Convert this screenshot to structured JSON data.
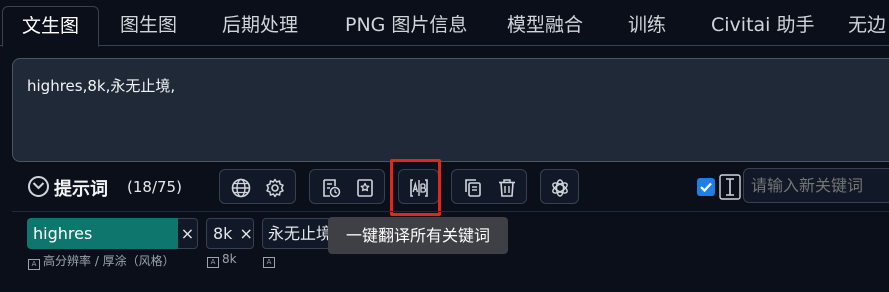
{
  "tabs": [
    "文生图",
    "图生图",
    "后期处理",
    "PNG 图片信息",
    "模型融合",
    "训练",
    "Civitai 助手",
    "无边"
  ],
  "prompt": {
    "text": "highres,8k,永无止境,"
  },
  "toolbar": {
    "title": "提示词",
    "count": "(18/75)",
    "input_placeholder": "请输入新关键词",
    "checkbox_checked": true
  },
  "icons": {
    "globe": "globe-icon",
    "settings": "gear-icon",
    "history": "history-list-icon",
    "favorite": "bookmark-star-icon",
    "translate": "translate-ab-icon",
    "copy": "copy-icon",
    "delete": "trash-icon",
    "chatgpt": "openai-icon"
  },
  "tags": [
    {
      "label": "highres",
      "close": "×",
      "translation": "高分辨率 / 厚涂（风格）"
    },
    {
      "label": "8k",
      "close": "×",
      "translation": "8k"
    },
    {
      "label": "永无止境",
      "close": "",
      "translation": ""
    }
  ],
  "tooltip": "一键翻译所有关键词",
  "colors": {
    "background": "#0b0f19",
    "tag_active": "#0f766e",
    "highlight": "#e5251c",
    "checkbox": "#1d7fe6"
  }
}
